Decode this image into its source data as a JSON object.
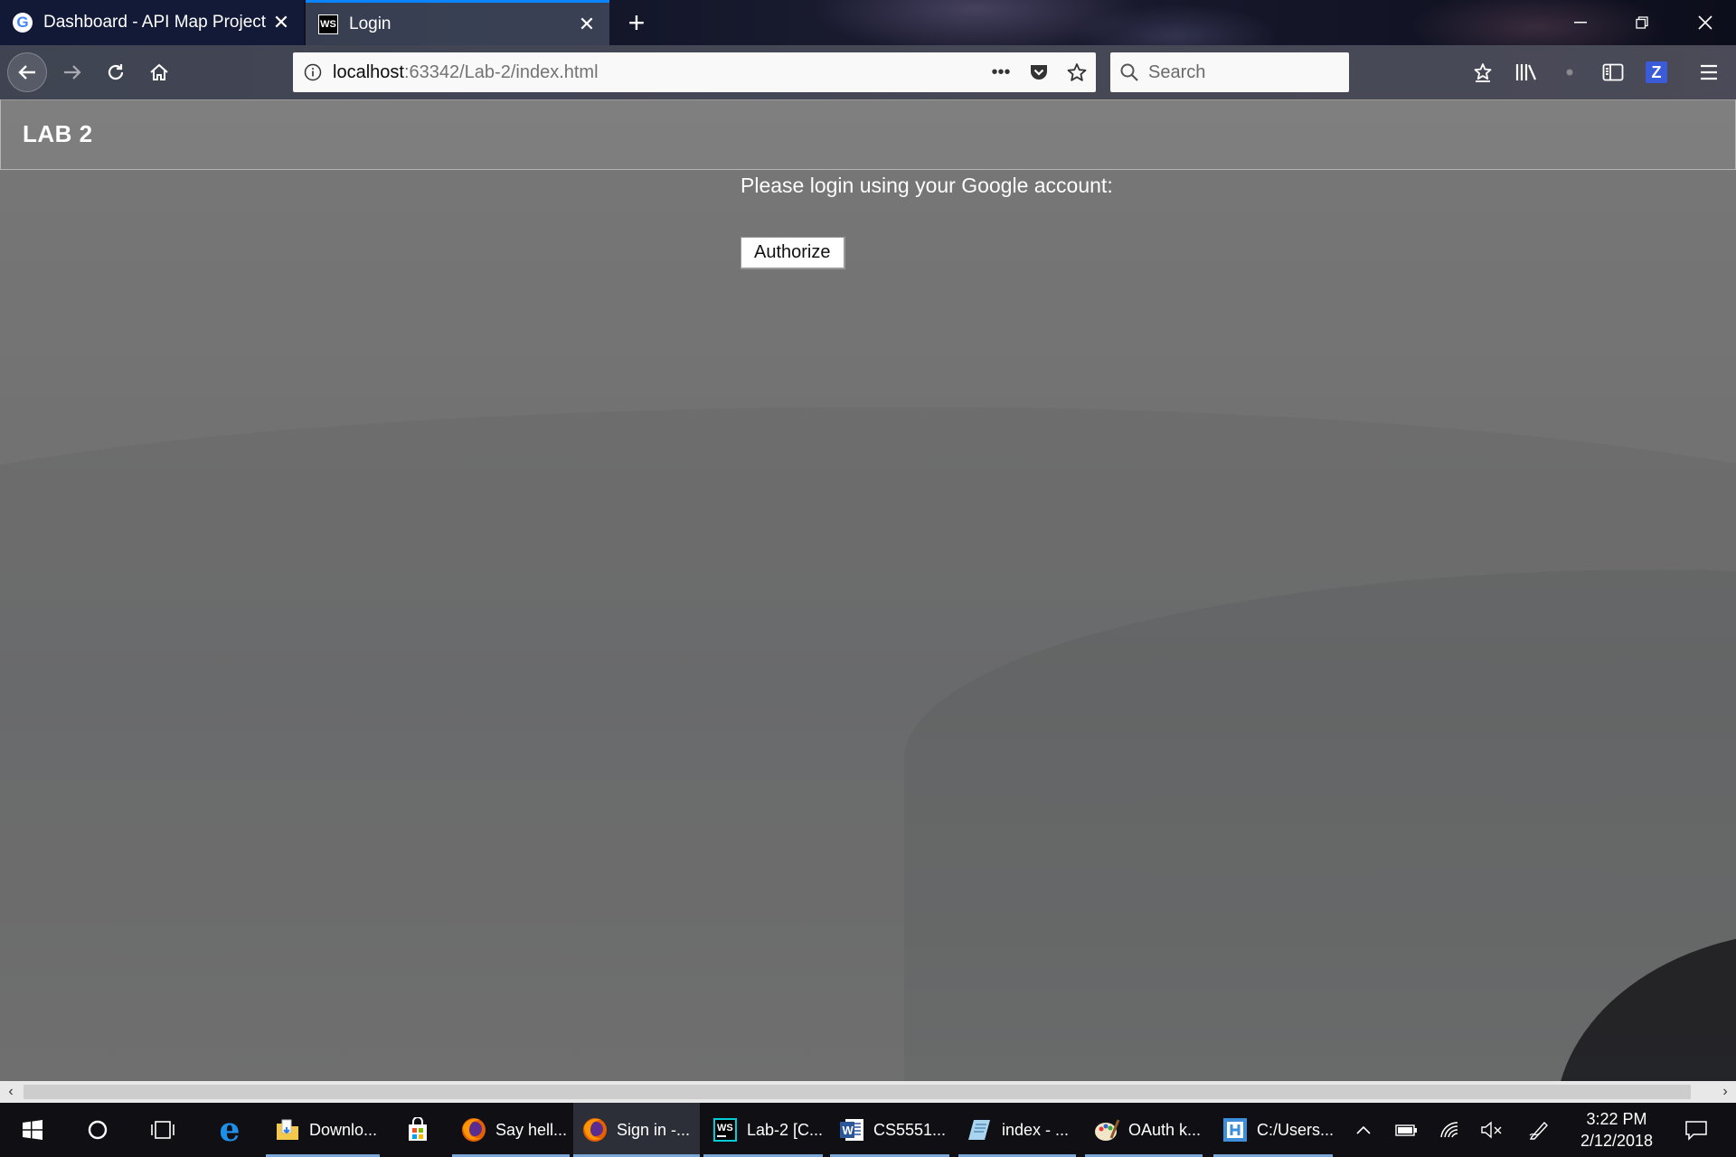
{
  "browser": {
    "tabs": [
      {
        "title": "Dashboard - API Map Project",
        "icon": "google-icon",
        "active": false
      },
      {
        "title": "Login",
        "icon": "webstorm-icon",
        "active": true
      }
    ],
    "url": {
      "host": "localhost",
      "path": ":63342/Lab-2/index.html"
    },
    "search": {
      "placeholder": "Search"
    },
    "accent_color": "#0a84ff"
  },
  "page": {
    "header_title": "LAB 2",
    "login_prompt": "Please login using your Google account:",
    "authorize_label": "Authorize"
  },
  "taskbar": {
    "apps": [
      {
        "label": "Downlo...",
        "icon": "file-explorer-icon"
      },
      {
        "label": "",
        "icon": "store-icon"
      },
      {
        "label": "Say hell...",
        "icon": "firefox-icon"
      },
      {
        "label": "Sign in -...",
        "icon": "firefox-icon"
      },
      {
        "label": "Lab-2 [C...",
        "icon": "webstorm-icon"
      },
      {
        "label": "CS5551...",
        "icon": "word-icon"
      },
      {
        "label": "index - ...",
        "icon": "notepad-icon"
      },
      {
        "label": "OAuth k...",
        "icon": "paint-icon"
      },
      {
        "label": "C:/Users...",
        "icon": "terminal-icon"
      }
    ],
    "clock": {
      "time": "3:22 PM",
      "date": "2/12/2018"
    }
  }
}
